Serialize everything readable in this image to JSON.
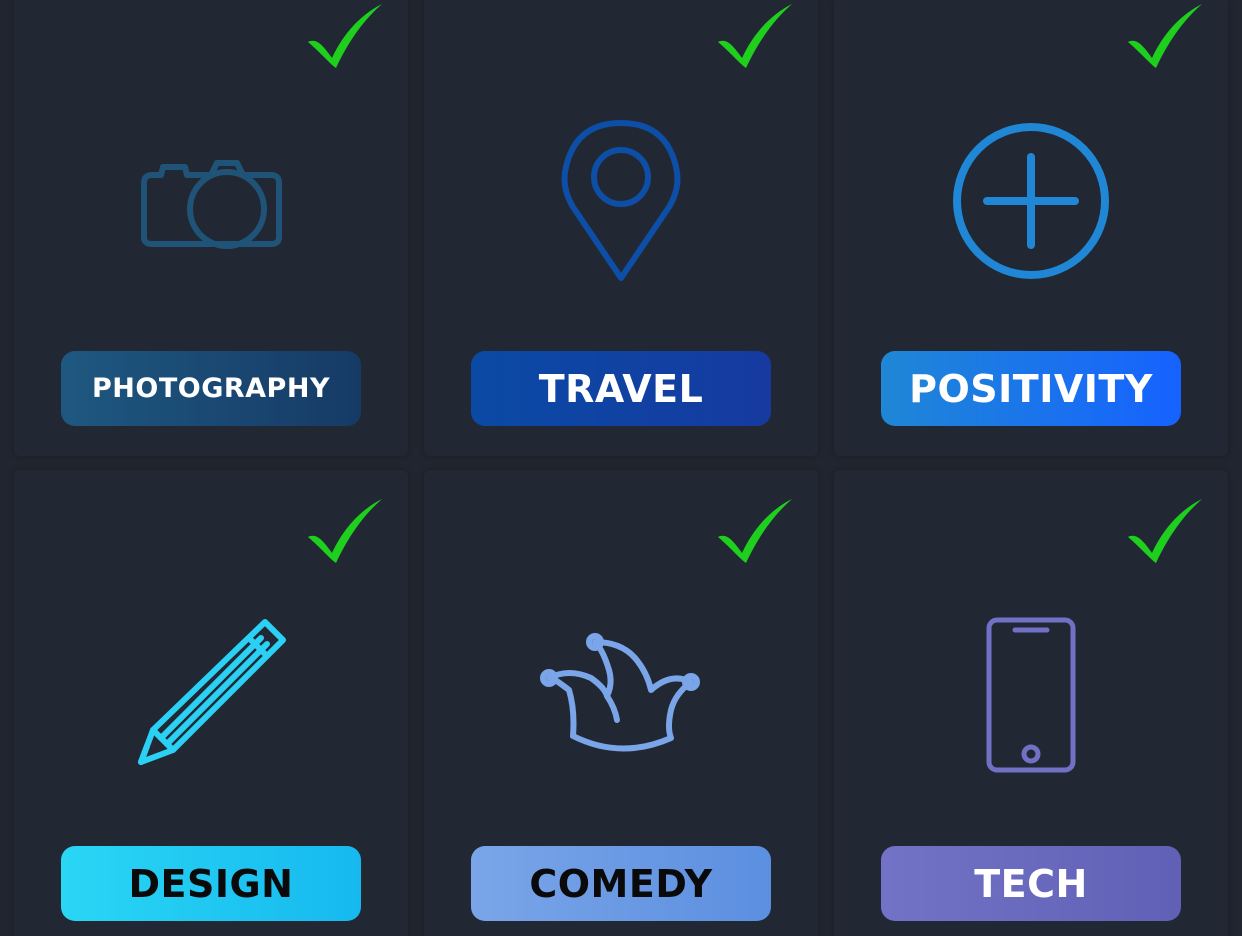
{
  "colors": {
    "background": "#20252f",
    "card": "#222833",
    "check": "#1ecf1e",
    "photography_icon": "#1f5478",
    "travel_icon": "#0d4ea6",
    "positivity_icon": "#1f87d6",
    "design_icon": "#2bd1f5",
    "comedy_icon": "#7aa5e8",
    "tech_icon": "#7070c4"
  },
  "categories": [
    {
      "label": "PHOTOGRAPHY",
      "icon": "camera-icon",
      "selected": true
    },
    {
      "label": "TRAVEL",
      "icon": "map-pin-icon",
      "selected": true
    },
    {
      "label": "POSITIVITY",
      "icon": "plus-circle-icon",
      "selected": true
    },
    {
      "label": "DESIGN",
      "icon": "pencil-icon",
      "selected": true
    },
    {
      "label": "COMEDY",
      "icon": "jester-hat-icon",
      "selected": true
    },
    {
      "label": "TECH",
      "icon": "smartphone-icon",
      "selected": true
    }
  ]
}
